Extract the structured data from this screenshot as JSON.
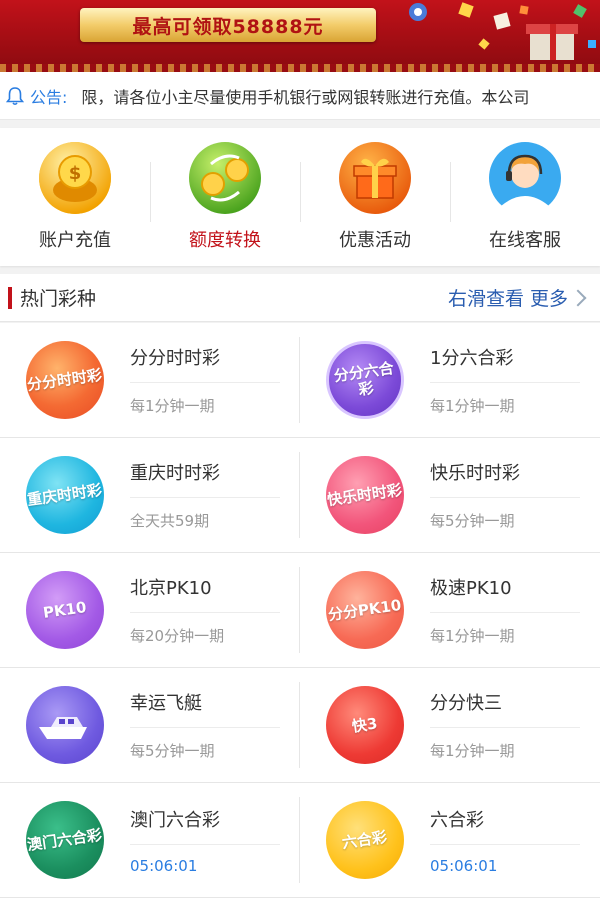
{
  "banner": {
    "headline": "最高可领取58888元"
  },
  "notice": {
    "label": "公告:",
    "text": "限，请各位小主尽量使用手机银行或网银转账进行充值。本公司"
  },
  "quick_menu": [
    {
      "label": "账户充值",
      "icon": "piggy-bank-icon",
      "active": false
    },
    {
      "label": "额度转换",
      "icon": "exchange-coins-icon",
      "active": true
    },
    {
      "label": "优惠活动",
      "icon": "gift-box-icon",
      "active": false
    },
    {
      "label": "在线客服",
      "icon": "customer-service-icon",
      "active": false
    }
  ],
  "section": {
    "title": "热门彩种",
    "more": "右滑查看 更多"
  },
  "games": [
    {
      "name": "分分时时彩",
      "sub": "每1分钟一期",
      "badge": "分分时时彩",
      "color": "i-red",
      "sub_blue": false
    },
    {
      "name": "1分六合彩",
      "sub": "每1分钟一期",
      "badge": "分分六合彩",
      "color": "i-purple",
      "sub_blue": false
    },
    {
      "name": "重庆时时彩",
      "sub": "全天共59期",
      "badge": "重庆时时彩",
      "color": "i-cyan",
      "sub_blue": false
    },
    {
      "name": "快乐时时彩",
      "sub": "每5分钟一期",
      "badge": "快乐时时彩",
      "color": "i-pink",
      "sub_blue": false
    },
    {
      "name": "北京PK10",
      "sub": "每20分钟一期",
      "badge": "PK10",
      "color": "i-violet",
      "sub_blue": false
    },
    {
      "name": "极速PK10",
      "sub": "每1分钟一期",
      "badge": "分分PK10",
      "color": "i-salmon",
      "sub_blue": false
    },
    {
      "name": "幸运飞艇",
      "sub": "每5分钟一期",
      "badge": "",
      "color": "i-indigo",
      "sub_blue": false
    },
    {
      "name": "分分快三",
      "sub": "每1分钟一期",
      "badge": "快3",
      "color": "i-crimson",
      "sub_blue": false
    },
    {
      "name": "澳门六合彩",
      "sub": "05:06:01",
      "badge": "澳门六合彩",
      "color": "i-green",
      "sub_blue": true
    },
    {
      "name": "六合彩",
      "sub": "05:06:01",
      "badge": "六合彩",
      "color": "i-gold",
      "sub_blue": true
    }
  ]
}
